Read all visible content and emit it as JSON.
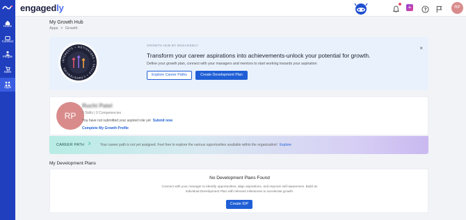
{
  "rail": {
    "items": [
      {
        "label": "Home",
        "icon": "home-icon"
      },
      {
        "label": "Connect",
        "icon": "connect-icon"
      },
      {
        "label": "People",
        "icon": "people-icon"
      },
      {
        "label": "Store",
        "icon": "cart-icon"
      },
      {
        "label": "Apps",
        "icon": "apps-icon",
        "active": true
      }
    ]
  },
  "topbar": {
    "brand_main": "engaged",
    "brand_accent": "ly",
    "avatar_initials": "RP"
  },
  "page": {
    "title": "My Growth Hub",
    "breadcrumb": [
      "Apps",
      ">",
      "Growth"
    ]
  },
  "hero": {
    "eyebrow": "GROWTH HUB BY ENGAGEDLY",
    "title": "Transform your career aspirations into achievements-unlock your potential for growth.",
    "subtitle": "Define your growth plan, connect with your managers and mentors to start working towards your aspiration",
    "explore_label": "Explore Career Paths",
    "create_label": "Create Development Plan",
    "close_glyph": "×",
    "ring_words": [
      "INTERESTS",
      "MOTIVATORS",
      "SKILLS",
      "COMPETENCIES"
    ]
  },
  "profile": {
    "initials": "RP",
    "name": "Ruchi Patel",
    "meta": "0 Skills  |  0 Competencies",
    "role_text": "You have not submitted your aspired role yet",
    "role_link": "Submit now",
    "complete_link": "Complete My Growth Profile"
  },
  "career": {
    "label": "CAREER PATH",
    "chevrons": "›››",
    "text": "Your career path is not yet assigned. Feel free to explore the various opportunities available within the organization!",
    "link": "Explore"
  },
  "plans": {
    "section_title": "My Development Plans",
    "empty_title": "No Development Plans Found",
    "empty_desc": "Connect with your manager to identify opportunities, align aspirations, and improve self-awareness. Build an Individual Development Plan with relevant milestones to accelerate growth.",
    "create_label": "Create IDP"
  },
  "colors": {
    "rail": "#1f3fbf",
    "primary": "#1f5fd6",
    "hero_bg": "#e9f1fc",
    "avatar": "#d98b8b"
  }
}
